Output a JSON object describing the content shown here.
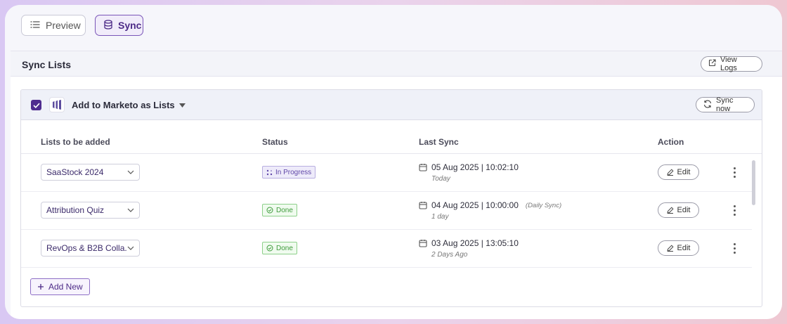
{
  "tabs": {
    "preview_label": "Preview",
    "sync_label": "Sync"
  },
  "panel": {
    "title": "Sync Lists",
    "view_logs_label": "View Logs"
  },
  "destination": {
    "label": "Add to Marketo as Lists",
    "checked": true,
    "sync_now_label": "Sync now"
  },
  "table": {
    "headers": {
      "lists": "Lists to be added",
      "status": "Status",
      "last_sync": "Last Sync",
      "action": "Action"
    },
    "rows": [
      {
        "list": "SaaStock 2024",
        "status": "In Progress",
        "status_type": "progress",
        "last_sync": "05 Aug 2025 | 10:02:10",
        "note": "",
        "relative": "Today",
        "edit_label": "Edit"
      },
      {
        "list": "Attribution Quiz",
        "status": "Done",
        "status_type": "done",
        "last_sync": "04 Aug 2025 | 10:00:00",
        "note": "(Daily Sync)",
        "relative": "1 day",
        "edit_label": "Edit"
      },
      {
        "list": "RevOps & B2B Colla...",
        "status": "Done",
        "status_type": "done",
        "last_sync": "03 Aug 2025 | 13:05:10",
        "note": "",
        "relative": "2 Days Ago",
        "edit_label": "Edit"
      }
    ]
  },
  "add_new_label": "Add New",
  "colors": {
    "accent": "#4f2c8f",
    "progress": "#6047a8",
    "done": "#3e9b3b"
  }
}
